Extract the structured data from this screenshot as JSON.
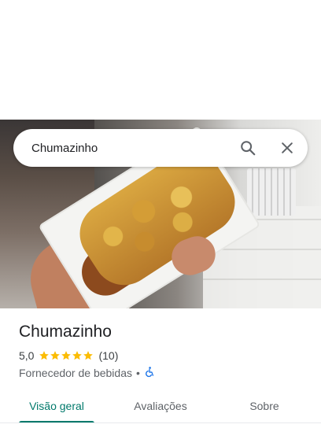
{
  "search": {
    "query": "Chumazinho",
    "search_icon": "search-icon",
    "close_icon": "close-icon"
  },
  "place": {
    "name": "Chumazinho",
    "rating": "5,0",
    "star_count": 5,
    "reviews": "(10)",
    "category": "Fornecedor de bebidas",
    "separator": "•",
    "accessibility_icon": "wheelchair-icon"
  },
  "tabs": [
    {
      "label": "Visão geral",
      "active": true
    },
    {
      "label": "Avaliações",
      "active": false
    },
    {
      "label": "Sobre",
      "active": false
    }
  ],
  "colors": {
    "accent": "#00796b",
    "star": "#fbbc04",
    "accessibility": "#1a73e8"
  }
}
